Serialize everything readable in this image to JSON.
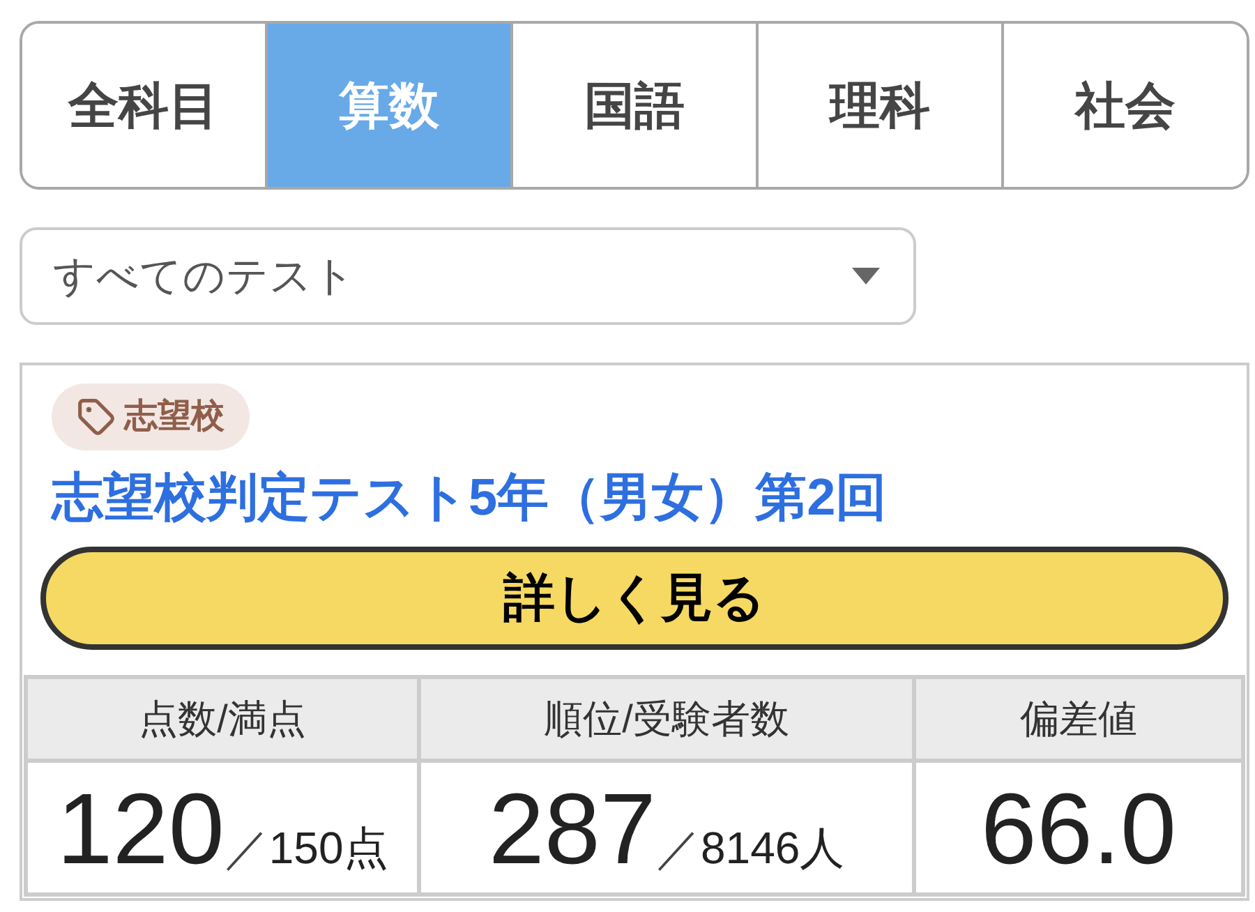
{
  "subject_tabs": [
    {
      "label": "全科目",
      "selected": false
    },
    {
      "label": "算数",
      "selected": true
    },
    {
      "label": "国語",
      "selected": false
    },
    {
      "label": "理科",
      "selected": false
    },
    {
      "label": "社会",
      "selected": false
    }
  ],
  "test_filter": {
    "value": "すべてのテスト"
  },
  "result_card": {
    "tag": {
      "label": "志望校"
    },
    "title": "志望校判定テスト5年（男女）第2回",
    "details_button": "詳しく見る",
    "stats": [
      {
        "header": "点数/満点",
        "value": "120",
        "separator": "／",
        "total": "150点"
      },
      {
        "header": "順位/受験者数",
        "value": "287",
        "separator": "／",
        "total": "8146人"
      },
      {
        "header": "偏差値",
        "value": "66.0"
      }
    ]
  }
}
